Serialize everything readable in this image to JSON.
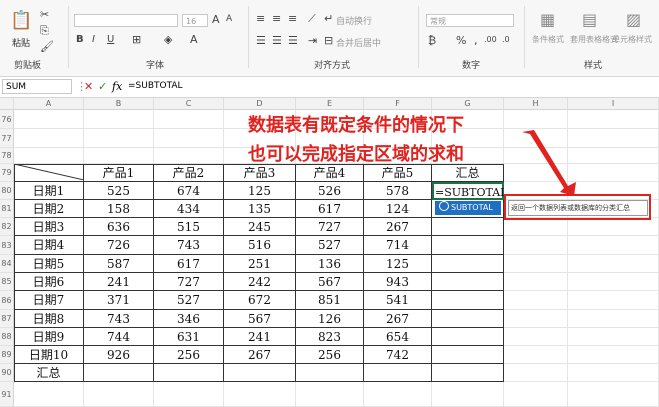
{
  "ribbon": {
    "clipboard": {
      "paste": "粘贴",
      "label": "剪贴板"
    },
    "font": {
      "label": "字体",
      "size_placeholder": "16"
    },
    "align": {
      "label": "对齐方式",
      "wrap": "自动换行",
      "merge": "合并后居中"
    },
    "number": {
      "label": "数字",
      "format": "常规"
    },
    "styles": {
      "label": "样式",
      "conditional": "条件格式",
      "table_style": "套用表格格式",
      "cell_style": "单元格样式"
    }
  },
  "formula_bar": {
    "name_box": "SUM",
    "formula": "=SUBTOTAL"
  },
  "columns": [
    "A",
    "B",
    "C",
    "D",
    "E",
    "F",
    "G",
    "H",
    "I"
  ],
  "rows": [
    "76",
    "77",
    "78",
    "79",
    "80",
    "81",
    "82",
    "83",
    "84",
    "85",
    "86",
    "87",
    "88",
    "89",
    "90",
    "91"
  ],
  "table": {
    "headers": [
      "产品1",
      "产品2",
      "产品3",
      "产品4",
      "产品5",
      "汇总"
    ],
    "row_labels": [
      "日期1",
      "日期2",
      "日期3",
      "日期4",
      "日期5",
      "日期6",
      "日期7",
      "日期8",
      "日期9",
      "日期10",
      "汇总"
    ],
    "values": [
      [
        "525",
        "674",
        "125",
        "526",
        "578"
      ],
      [
        "158",
        "434",
        "135",
        "617",
        "124"
      ],
      [
        "636",
        "515",
        "245",
        "727",
        "267"
      ],
      [
        "726",
        "743",
        "516",
        "527",
        "714"
      ],
      [
        "587",
        "617",
        "251",
        "136",
        "125"
      ],
      [
        "241",
        "727",
        "242",
        "567",
        "943"
      ],
      [
        "371",
        "527",
        "672",
        "851",
        "541"
      ],
      [
        "743",
        "346",
        "567",
        "126",
        "267"
      ],
      [
        "744",
        "631",
        "241",
        "823",
        "654"
      ],
      [
        "926",
        "256",
        "267",
        "256",
        "742"
      ]
    ],
    "editing_cell": "=SUBTOTAL"
  },
  "autocomplete": {
    "item": "SUBTOTAL",
    "tooltip": "返回一个数据列表或数据库的分类汇总"
  },
  "callout": {
    "line1": "数据表有既定条件的情况下",
    "line2": "也可以完成指定区域的求和"
  },
  "colors": {
    "accent": "#e0231f",
    "selection": "#1f6fc2"
  }
}
